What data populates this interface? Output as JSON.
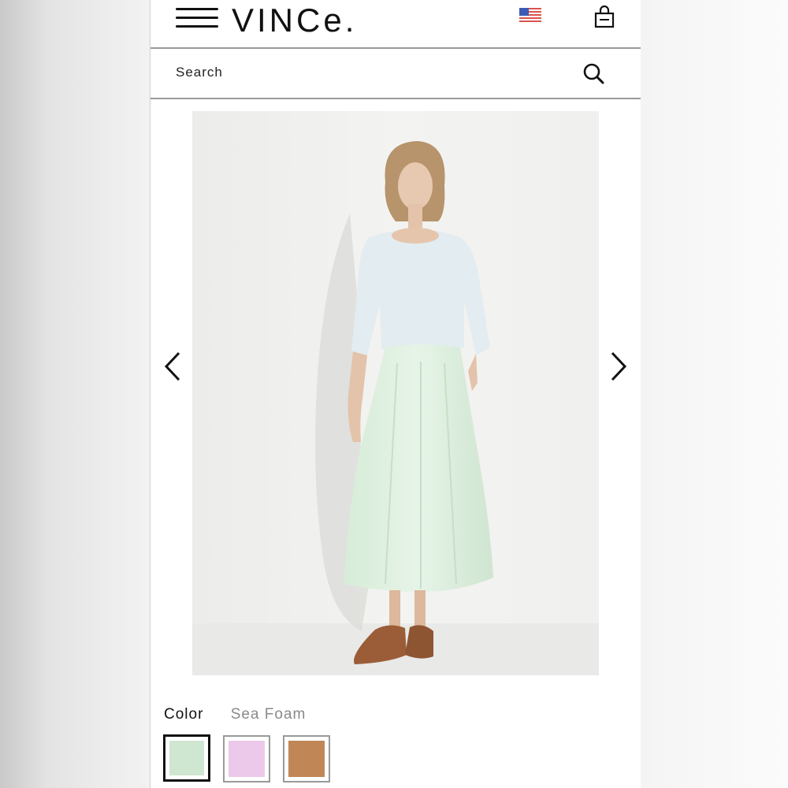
{
  "header": {
    "brand": "VINCe.",
    "menu_icon": "hamburger-menu-icon",
    "country_icon": "us-flag-icon",
    "bag_icon": "shopping-bag-icon"
  },
  "search": {
    "placeholder": "Search",
    "icon": "search-icon"
  },
  "product": {
    "image_icon": "model-photo",
    "prev_icon": "chevron-left-icon",
    "next_icon": "chevron-right-icon",
    "color_label": "Color",
    "selected_color": "Sea Foam",
    "swatches": [
      {
        "color": "#cfe6d1",
        "selected": true
      },
      {
        "color": "#ecc9ea",
        "selected": false
      },
      {
        "color": "#c08655",
        "selected": false
      }
    ]
  },
  "colors": {
    "text": "#111111",
    "muted": "#8a8a8a",
    "divider": "#9a9a9a"
  }
}
